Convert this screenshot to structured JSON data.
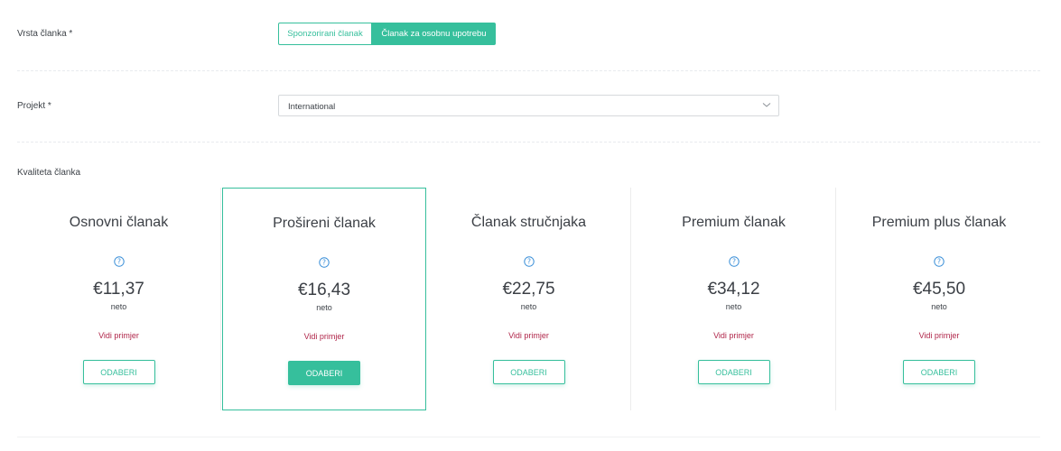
{
  "article_type": {
    "label": "Vrsta članka *",
    "options": [
      "Sponzorirani članak",
      "Članak za osobnu upotrebu"
    ],
    "selected": "Članak za osobnu upotrebu"
  },
  "project": {
    "label": "Projekt *",
    "value": "International",
    "icon": "chevron-down-icon"
  },
  "quality": {
    "label": "Kvaliteta članka",
    "cards": [
      {
        "title": "Osnovni članak",
        "price": "€11,37",
        "net": "neto",
        "example": "Vidi primjer",
        "button": "ODABERI",
        "selected": false
      },
      {
        "title": "Prošireni članak",
        "price": "€16,43",
        "net": "neto",
        "example": "Vidi primjer",
        "button": "ODABERI",
        "selected": true
      },
      {
        "title": "Članak stručnjaka",
        "price": "€22,75",
        "net": "neto",
        "example": "Vidi primjer",
        "button": "ODABERI",
        "selected": false
      },
      {
        "title": "Premium članak",
        "price": "€34,12",
        "net": "neto",
        "example": "Vidi primjer",
        "button": "ODABERI",
        "selected": false
      },
      {
        "title": "Premium plus članak",
        "price": "€45,50",
        "net": "neto",
        "example": "Vidi primjer",
        "button": "ODABERI",
        "selected": false
      }
    ]
  },
  "colors": {
    "accent": "#36bf9c",
    "link": "#b0264a",
    "help_icon": "#3a8fd8"
  }
}
